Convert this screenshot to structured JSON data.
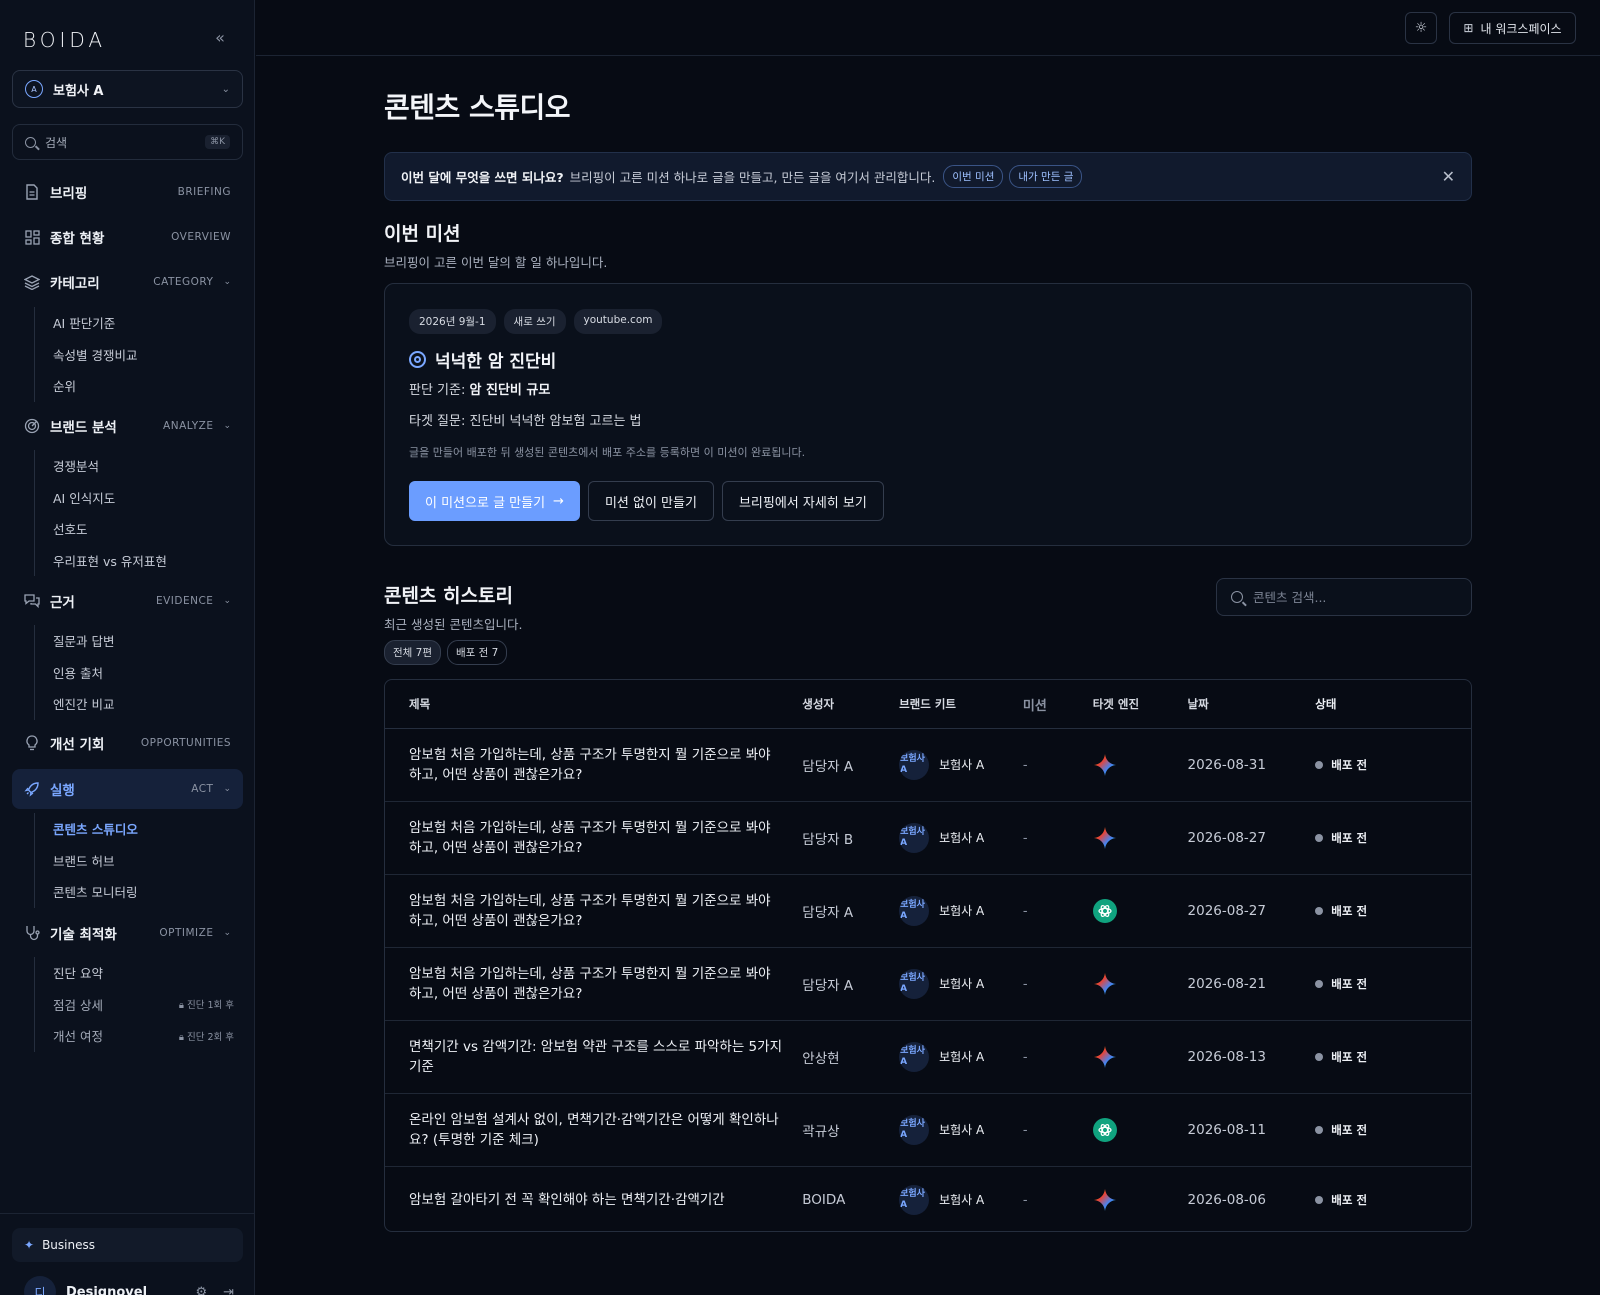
{
  "sidebar": {
    "logo": "BOIDA",
    "workspace": {
      "avatar": "A",
      "name": "보험사 A"
    },
    "search": {
      "placeholder": "검색",
      "shortcut": "⌘K"
    },
    "sections": [
      {
        "label": "브리핑",
        "en": "BRIEFING",
        "icon": "document-icon"
      },
      {
        "label": "종합 현황",
        "en": "OVERVIEW",
        "icon": "grid-icon"
      },
      {
        "label": "카테고리",
        "en": "CATEGORY",
        "icon": "layers-icon",
        "items": [
          "AI 판단기준",
          "속성별 경쟁비교",
          "순위"
        ]
      },
      {
        "label": "브랜드 분석",
        "en": "ANALYZE",
        "icon": "radar-icon",
        "items": [
          "경쟁분석",
          "AI 인식지도",
          "선호도",
          "우리표현 vs 유저표현"
        ]
      },
      {
        "label": "근거",
        "en": "EVIDENCE",
        "icon": "chat-icon",
        "items": [
          "질문과 답변",
          "인용 출처",
          "엔진간 비교"
        ]
      },
      {
        "label": "개선 기회",
        "en": "OPPORTUNITIES",
        "icon": "bulb-icon"
      },
      {
        "label": "실행",
        "en": "ACT",
        "icon": "rocket-icon",
        "items": [
          "콘텐츠 스튜디오",
          "브랜드 허브",
          "콘텐츠 모니터링"
        ]
      },
      {
        "label": "기술 최적화",
        "en": "OPTIMIZE",
        "icon": "stethoscope-icon",
        "items": [
          "진단 요약",
          "점검 상세",
          "개선 여정"
        ],
        "locks": [
          "",
          "진단 1회 후",
          "진단 2회 후"
        ]
      }
    ],
    "plan": "Business",
    "user": {
      "avatar": "디",
      "name": "Designovel"
    }
  },
  "topbar": {
    "workspace_button": "내 워크스페이스"
  },
  "page": {
    "title": "콘텐츠 스튜디오",
    "banner": {
      "question": "이번 달에 무엇을 쓰면 되나요?",
      "text": "브리핑이 고른 미션 하나로 글을 만들고, 만든 글을 여기서 관리합니다.",
      "chips": [
        "이번 미션",
        "내가 만든 글"
      ]
    },
    "mission_section": {
      "title": "이번 미션",
      "subtitle": "브리핑이 고른 이번 달의 할 일 하나입니다."
    },
    "mission": {
      "tags": [
        "2026년 9월-1",
        "새로 쓰기",
        "youtube.com"
      ],
      "title": "넉넉한 암 진단비",
      "criteria_label": "판단 기준:",
      "criteria_value": "암 진단비 규모",
      "target_question": "타겟 질문: 진단비 넉넉한 암보험 고르는 법",
      "note": "글을 만들어 배포한 뒤 생성된 콘텐츠에서 배포 주소를 등록하면 이 미션이 완료됩니다.",
      "buttons": {
        "primary": "이 미션으로 글 만들기",
        "no_mission": "미션 없이 만들기",
        "briefing": "브리핑에서 자세히 보기"
      }
    },
    "history": {
      "title": "콘텐츠 히스토리",
      "subtitle": "최근 생성된 콘텐츠입니다.",
      "search_placeholder": "콘텐츠 검색...",
      "filters": [
        "전체 7편",
        "배포 전 7"
      ],
      "columns": [
        "제목",
        "생성자",
        "브랜드 키트",
        "미션",
        "타겟 엔진",
        "날짜",
        "상태"
      ],
      "rows": [
        {
          "title": "암보험 처음 가입하는데, 상품 구조가 투명한지 뭘 기준으로 봐야 하고, 어떤 상품이 괜찮은가요?",
          "author": "담당자 A",
          "kit_avatar": "보험사 A",
          "kit": "보험사 A",
          "mission": "-",
          "engine": "gemini-icon",
          "date": "2026-08-31",
          "status": "배포 전"
        },
        {
          "title": "암보험 처음 가입하는데, 상품 구조가 투명한지 뭘 기준으로 봐야 하고, 어떤 상품이 괜찮은가요?",
          "author": "담당자 B",
          "kit_avatar": "보험사 A",
          "kit": "보험사 A",
          "mission": "-",
          "engine": "gemini-icon",
          "date": "2026-08-27",
          "status": "배포 전"
        },
        {
          "title": "암보험 처음 가입하는데, 상품 구조가 투명한지 뭘 기준으로 봐야 하고, 어떤 상품이 괜찮은가요?",
          "author": "담당자 A",
          "kit_avatar": "보험사 A",
          "kit": "보험사 A",
          "mission": "-",
          "engine": "chatgpt-icon",
          "date": "2026-08-27",
          "status": "배포 전"
        },
        {
          "title": "암보험 처음 가입하는데, 상품 구조가 투명한지 뭘 기준으로 봐야 하고, 어떤 상품이 괜찮은가요?",
          "author": "담당자 A",
          "kit_avatar": "보험사 A",
          "kit": "보험사 A",
          "mission": "-",
          "engine": "gemini-icon",
          "date": "2026-08-21",
          "status": "배포 전"
        },
        {
          "title": "면책기간 vs 감액기간: 암보험 약관 구조를 스스로 파악하는 5가지 기준",
          "author": "안상현",
          "kit_avatar": "보험사 A",
          "kit": "보험사 A",
          "mission": "-",
          "engine": "gemini-icon",
          "date": "2026-08-13",
          "status": "배포 전"
        },
        {
          "title": "온라인 암보험 설계사 없이, 면책기간·감액기간은 어떻게 확인하나요? (투명한 기준 체크)",
          "author": "곽규상",
          "kit_avatar": "보험사 A",
          "kit": "보험사 A",
          "mission": "-",
          "engine": "chatgpt-icon",
          "date": "2026-08-11",
          "status": "배포 전"
        },
        {
          "title": "암보험 갈아타기 전 꼭 확인해야 하는 면책기간·감액기간",
          "author": "BOIDA",
          "kit_avatar": "보험사 A",
          "kit": "보험사 A",
          "mission": "-",
          "engine": "gemini-icon",
          "date": "2026-08-06",
          "status": "배포 전"
        }
      ]
    }
  }
}
